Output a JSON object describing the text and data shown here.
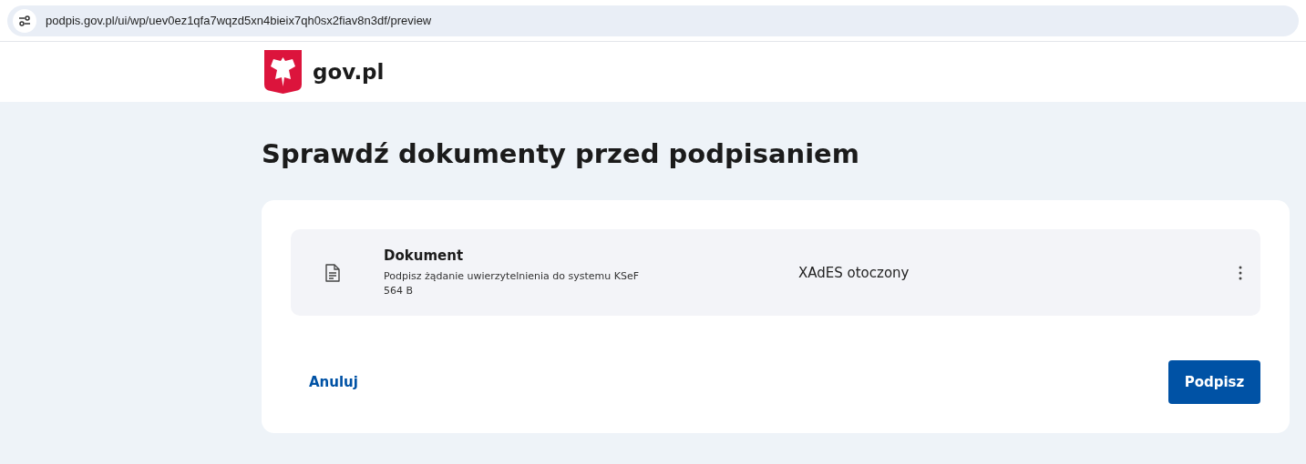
{
  "browser": {
    "url": "podpis.gov.pl/ui/wp/uev0ez1qfa7wqzd5xn4bieix7qh0sx2fiav8n3df/preview"
  },
  "header": {
    "logo_text": "gov.pl"
  },
  "page": {
    "title": "Sprawdź dokumenty przed podpisaniem"
  },
  "documents": [
    {
      "name": "Dokument",
      "description": "Podpisz żądanie uwierzytelnienia do systemu KSeF",
      "size": "564 B",
      "format": "XAdES otoczony"
    }
  ],
  "actions": {
    "cancel": "Anuluj",
    "sign": "Podpisz"
  }
}
